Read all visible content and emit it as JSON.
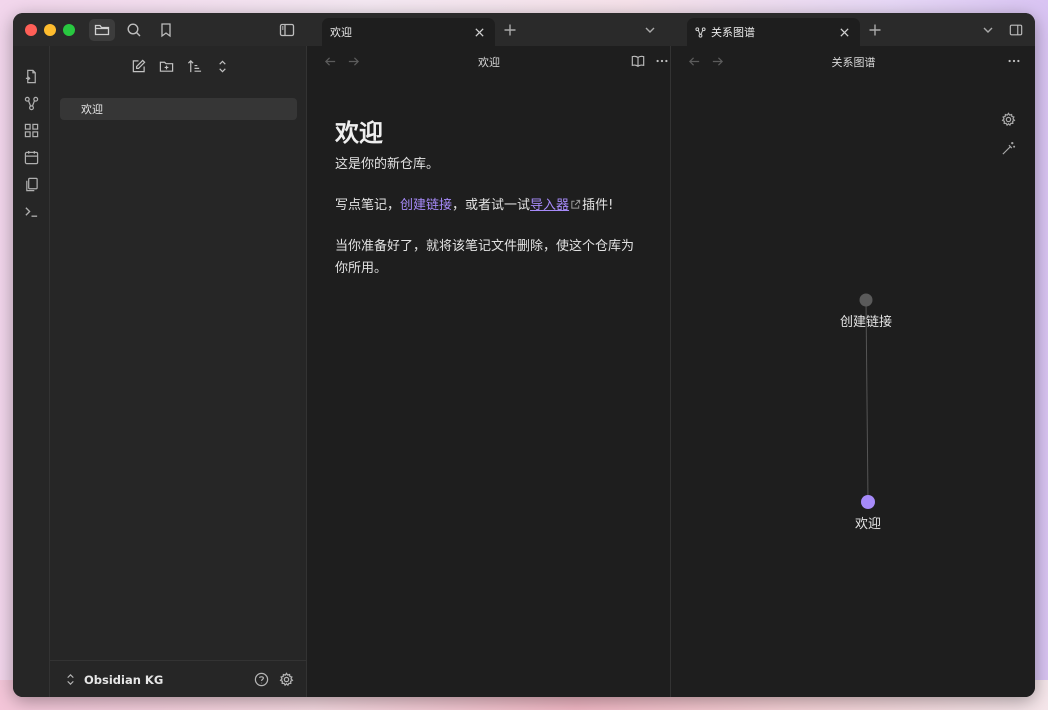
{
  "theme": {
    "accent": "#a68af9",
    "background": "#1e1e1e",
    "sidebar_bg": "#262626"
  },
  "titlebar": {
    "left_icons": [
      "folder-icon",
      "search-icon",
      "bookmark-icon"
    ],
    "sidebar_toggle_icon": "sidebar-left-icon"
  },
  "tabs": {
    "left": {
      "label": "欢迎"
    },
    "right": {
      "label": "关系图谱",
      "icon": "graph-icon"
    }
  },
  "ribbon": {
    "icons": [
      "open-quick-switcher-icon",
      "graph-view-icon",
      "canvas-icon",
      "daily-notes-icon",
      "templates-icon",
      "command-palette-icon"
    ]
  },
  "sidebar": {
    "toolbar": [
      "new-note-icon",
      "new-folder-icon",
      "sort-icon",
      "collapse-icon"
    ],
    "files": [
      {
        "name": "欢迎"
      }
    ],
    "vault_name": "Obsidian KG"
  },
  "note": {
    "header_title": "欢迎",
    "title": "欢迎",
    "paragraph1": "这是你的新仓库。",
    "paragraph2_before": "写点笔记，",
    "paragraph2_link1": "创建链接",
    "paragraph2_middle": "，或者试一试",
    "paragraph2_link2": "导入器",
    "paragraph2_after": "插件!",
    "paragraph3": "当你准备好了，就将该笔记文件删除，使这个仓库为你所用。"
  },
  "graph": {
    "header_title": "关系图谱",
    "nodes": [
      {
        "label": "创建链接",
        "color": "#5a5a5a"
      },
      {
        "label": "欢迎",
        "color": "#a68af9"
      }
    ],
    "edges": [
      [
        "创建链接",
        "欢迎"
      ]
    ]
  }
}
